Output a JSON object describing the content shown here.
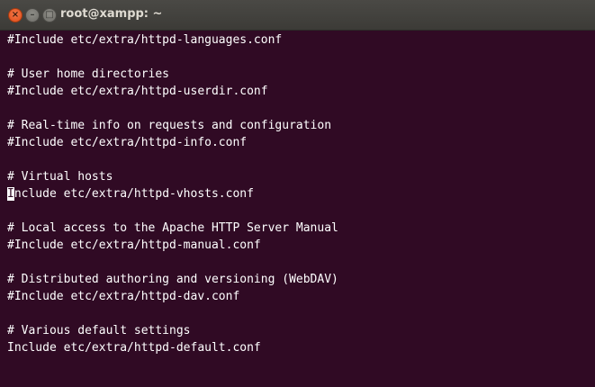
{
  "window": {
    "title": "root@xampp: ~",
    "controls": {
      "close_glyph": "×",
      "minimize_glyph": "–",
      "maximize_glyph": "□"
    }
  },
  "terminal": {
    "lines": [
      "#Include etc/extra/httpd-languages.conf",
      "",
      "# User home directories",
      "#Include etc/extra/httpd-userdir.conf",
      "",
      "# Real-time info on requests and configuration",
      "#Include etc/extra/httpd-info.conf",
      "",
      "# Virtual hosts",
      "Include etc/extra/httpd-vhosts.conf",
      "",
      "# Local access to the Apache HTTP Server Manual",
      "#Include etc/extra/httpd-manual.conf",
      "",
      "# Distributed authoring and versioning (WebDAV)",
      "#Include etc/extra/httpd-dav.conf",
      "",
      "# Various default settings",
      "Include etc/extra/httpd-default.conf"
    ],
    "cursor_line": {
      "cursor_char": "I",
      "rest": "nclude etc/extra/httpd-vhosts.conf"
    }
  },
  "colors": {
    "background": "#300a24",
    "text": "#ffffff",
    "titlebar": "#3c3b37",
    "close_button": "#df4a16"
  }
}
